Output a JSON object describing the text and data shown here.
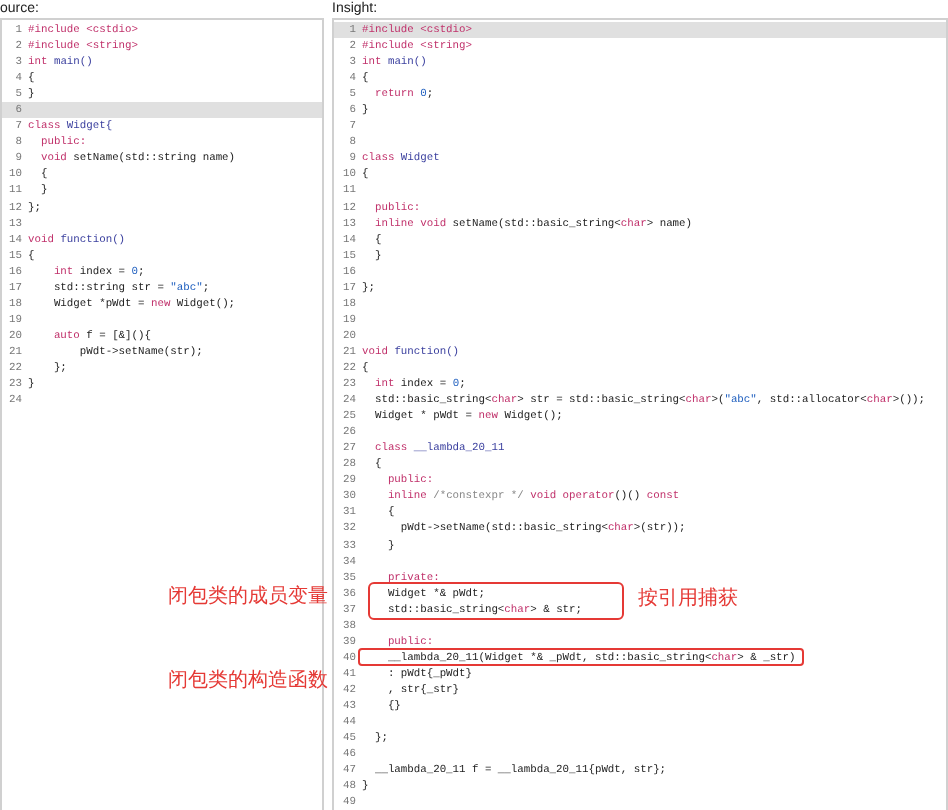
{
  "panes": [
    {
      "label": "ource:",
      "lines": [
        {
          "no": "1",
          "highlighted": false,
          "code": [
            {
              "text": "#include <cstdio>",
              "kind": "kw"
            }
          ]
        },
        {
          "no": "2",
          "highlighted": false,
          "code": [
            {
              "text": "#include <string>",
              "kind": "kw"
            }
          ]
        },
        {
          "no": "3",
          "highlighted": false,
          "code": [
            {
              "text": "int",
              "kind": "kw"
            },
            {
              "text": " main()",
              "kind": "fn"
            }
          ]
        },
        {
          "no": "4",
          "highlighted": false,
          "code": [
            {
              "text": "{",
              "kind": "plain"
            }
          ]
        },
        {
          "no": "5",
          "highlighted": false,
          "code": [
            {
              "text": "}",
              "kind": "plain"
            }
          ]
        },
        {
          "no": "6",
          "highlighted": true
        },
        {
          "no": "7",
          "highlighted": false,
          "code": [
            {
              "text": "class",
              "kind": "kw"
            },
            {
              "text": " Widget{",
              "kind": "fn"
            }
          ]
        },
        {
          "no": "8",
          "highlighted": false,
          "code": [
            {
              "text": "  public:",
              "kind": "kw"
            }
          ]
        },
        {
          "no": "9",
          "highlighted": false,
          "code": [
            {
              "text": "  void",
              "kind": "kw"
            },
            {
              "text": " setName(std::string name)",
              "kind": "plain"
            }
          ]
        },
        {
          "no": "10",
          "highlighted": false,
          "code": [
            {
              "text": "  {",
              "kind": "plain"
            }
          ]
        },
        {
          "no": "11",
          "highlighted": false,
          "code": [
            {
              "text": "  }",
              "kind": "plain"
            }
          ]
        },
        {
          "no": "12",
          "highlighted": false,
          "code": [
            {
              "text": "};",
              "kind": "plain"
            }
          ]
        },
        {
          "no": "13",
          "highlighted": false
        },
        {
          "no": "14",
          "highlighted": false,
          "code": [
            {
              "text": "void",
              "kind": "kw"
            },
            {
              "text": " function()",
              "kind": "fn"
            }
          ]
        },
        {
          "no": "15",
          "highlighted": false,
          "code": [
            {
              "text": "{",
              "kind": "plain"
            }
          ]
        },
        {
          "no": "16",
          "highlighted": false,
          "code": [
            {
              "text": "    int",
              "kind": "kw"
            },
            {
              "text": " index = ",
              "kind": "plain"
            },
            {
              "text": "0",
              "kind": "num"
            },
            {
              "text": ";",
              "kind": "plain"
            }
          ]
        },
        {
          "no": "17",
          "highlighted": false,
          "code": [
            {
              "text": "    std::string str = ",
              "kind": "plain"
            },
            {
              "text": "\"abc\"",
              "kind": "num"
            },
            {
              "text": ";",
              "kind": "plain"
            }
          ]
        },
        {
          "no": "18",
          "highlighted": false,
          "code": [
            {
              "text": "    Widget *pWdt = ",
              "kind": "plain"
            },
            {
              "text": "new",
              "kind": "kw"
            },
            {
              "text": " Widget();",
              "kind": "plain"
            }
          ]
        },
        {
          "no": "19",
          "highlighted": false
        },
        {
          "no": "20",
          "highlighted": false,
          "code": [
            {
              "text": "    auto",
              "kind": "kw"
            },
            {
              "text": " f = [&](){",
              "kind": "plain"
            }
          ]
        },
        {
          "no": "21",
          "highlighted": false,
          "code": [
            {
              "text": "        pWdt->setName(str);",
              "kind": "plain"
            }
          ]
        },
        {
          "no": "22",
          "highlighted": false,
          "code": [
            {
              "text": "    };",
              "kind": "plain"
            }
          ]
        },
        {
          "no": "23",
          "highlighted": false,
          "code": [
            {
              "text": "}",
              "kind": "plain"
            }
          ]
        },
        {
          "no": "24",
          "highlighted": false
        }
      ]
    },
    {
      "label": "Insight:",
      "lines": [
        {
          "no": "1",
          "highlighted": true,
          "code": [
            {
              "text": "#include <cstdio>",
              "kind": "kw"
            }
          ]
        },
        {
          "no": "2",
          "highlighted": false,
          "code": [
            {
              "text": "#include <string>",
              "kind": "kw"
            }
          ]
        },
        {
          "no": "3",
          "highlighted": false,
          "code": [
            {
              "text": "int",
              "kind": "kw"
            },
            {
              "text": " main()",
              "kind": "fn"
            }
          ]
        },
        {
          "no": "4",
          "highlighted": false,
          "code": [
            {
              "text": "{",
              "kind": "plain"
            }
          ]
        },
        {
          "no": "5",
          "highlighted": false,
          "code": [
            {
              "text": "  return",
              "kind": "kw"
            },
            {
              "text": " 0",
              "kind": "num"
            },
            {
              "text": ";",
              "kind": "plain"
            }
          ]
        },
        {
          "no": "6",
          "highlighted": false,
          "code": [
            {
              "text": "}",
              "kind": "plain"
            }
          ]
        },
        {
          "no": "7",
          "highlighted": false
        },
        {
          "no": "8",
          "highlighted": false
        },
        {
          "no": "9",
          "highlighted": false,
          "code": [
            {
              "text": "class",
              "kind": "kw"
            },
            {
              "text": " Widget",
              "kind": "fn"
            }
          ]
        },
        {
          "no": "10",
          "highlighted": false,
          "code": [
            {
              "text": "{",
              "kind": "plain"
            }
          ]
        },
        {
          "no": "11",
          "highlighted": false
        },
        {
          "no": "12",
          "highlighted": false,
          "code": [
            {
              "text": "  public:",
              "kind": "kw"
            }
          ]
        },
        {
          "no": "13",
          "highlighted": false,
          "code": [
            {
              "text": "  inline void",
              "kind": "kw"
            },
            {
              "text": " setName(std::basic_string<",
              "kind": "plain"
            },
            {
              "text": "char",
              "kind": "kw"
            },
            {
              "text": "> name)",
              "kind": "plain"
            }
          ]
        },
        {
          "no": "14",
          "highlighted": false,
          "code": [
            {
              "text": "  {",
              "kind": "plain"
            }
          ]
        },
        {
          "no": "15",
          "highlighted": false,
          "code": [
            {
              "text": "  }",
              "kind": "plain"
            }
          ]
        },
        {
          "no": "16",
          "highlighted": false
        },
        {
          "no": "17",
          "highlighted": false,
          "code": [
            {
              "text": "};",
              "kind": "plain"
            }
          ]
        },
        {
          "no": "18",
          "highlighted": false
        },
        {
          "no": "19",
          "highlighted": false
        },
        {
          "no": "20",
          "highlighted": false
        },
        {
          "no": "21",
          "highlighted": false,
          "code": [
            {
              "text": "void",
              "kind": "kw"
            },
            {
              "text": " function()",
              "kind": "fn"
            }
          ]
        },
        {
          "no": "22",
          "highlighted": false,
          "code": [
            {
              "text": "{",
              "kind": "plain"
            }
          ]
        },
        {
          "no": "23",
          "highlighted": false,
          "code": [
            {
              "text": "  int",
              "kind": "kw"
            },
            {
              "text": " index = ",
              "kind": "plain"
            },
            {
              "text": "0",
              "kind": "num"
            },
            {
              "text": ";",
              "kind": "plain"
            }
          ]
        },
        {
          "no": "24",
          "highlighted": false,
          "code": [
            {
              "text": "  std::basic_string<",
              "kind": "plain"
            },
            {
              "text": "char",
              "kind": "kw"
            },
            {
              "text": "> str = std::basic_string<",
              "kind": "plain"
            },
            {
              "text": "char",
              "kind": "kw"
            },
            {
              "text": ">(",
              "kind": "plain"
            },
            {
              "text": "\"abc\"",
              "kind": "num"
            },
            {
              "text": ", std::allocator<",
              "kind": "plain"
            },
            {
              "text": "char",
              "kind": "kw"
            },
            {
              "text": ">());",
              "kind": "plain"
            }
          ]
        },
        {
          "no": "25",
          "highlighted": false,
          "code": [
            {
              "text": "  Widget * pWdt = ",
              "kind": "plain"
            },
            {
              "text": "new",
              "kind": "kw"
            },
            {
              "text": " Widget();",
              "kind": "plain"
            }
          ]
        },
        {
          "no": "26",
          "highlighted": false
        },
        {
          "no": "27",
          "highlighted": false,
          "code": [
            {
              "text": "  class",
              "kind": "kw"
            },
            {
              "text": " __lambda_20_11",
              "kind": "fn"
            }
          ]
        },
        {
          "no": "28",
          "highlighted": false,
          "code": [
            {
              "text": "  {",
              "kind": "plain"
            }
          ]
        },
        {
          "no": "29",
          "highlighted": false,
          "code": [
            {
              "text": "    public:",
              "kind": "kw"
            }
          ]
        },
        {
          "no": "30",
          "highlighted": false,
          "code": [
            {
              "text": "    inline",
              "kind": "kw"
            },
            {
              "text": " /*constexpr */",
              "kind": "cmt"
            },
            {
              "text": " void operator",
              "kind": "kw"
            },
            {
              "text": "()() ",
              "kind": "plain"
            },
            {
              "text": "const",
              "kind": "kw"
            }
          ]
        },
        {
          "no": "31",
          "highlighted": false,
          "code": [
            {
              "text": "    {",
              "kind": "plain"
            }
          ]
        },
        {
          "no": "32",
          "highlighted": false,
          "code": [
            {
              "text": "      pWdt->setName(std::basic_string<",
              "kind": "plain"
            },
            {
              "text": "char",
              "kind": "kw"
            },
            {
              "text": ">(str));",
              "kind": "plain"
            }
          ]
        },
        {
          "no": "33",
          "highlighted": false,
          "code": [
            {
              "text": "    }",
              "kind": "plain"
            }
          ]
        },
        {
          "no": "34",
          "highlighted": false
        },
        {
          "no": "35",
          "highlighted": false,
          "code": [
            {
              "text": "    private:",
              "kind": "kw"
            }
          ]
        },
        {
          "no": "36",
          "highlighted": false,
          "code": [
            {
              "text": "    Widget *& pWdt;",
              "kind": "plain"
            }
          ]
        },
        {
          "no": "37",
          "highlighted": false,
          "code": [
            {
              "text": "    std::basic_string<",
              "kind": "plain"
            },
            {
              "text": "char",
              "kind": "kw"
            },
            {
              "text": "> & str;",
              "kind": "plain"
            }
          ]
        },
        {
          "no": "38",
          "highlighted": false
        },
        {
          "no": "39",
          "highlighted": false,
          "code": [
            {
              "text": "    public:",
              "kind": "kw"
            }
          ]
        },
        {
          "no": "40",
          "highlighted": false,
          "code": [
            {
              "text": "    __lambda_20_11(Widget *& _pWdt, std::basic_string<",
              "kind": "plain"
            },
            {
              "text": "char",
              "kind": "kw"
            },
            {
              "text": "> & _str)",
              "kind": "plain"
            }
          ]
        },
        {
          "no": "41",
          "highlighted": false,
          "code": [
            {
              "text": "    : pWdt{_pWdt}",
              "kind": "plain"
            }
          ]
        },
        {
          "no": "42",
          "highlighted": false,
          "code": [
            {
              "text": "    , str{_str}",
              "kind": "plain"
            }
          ]
        },
        {
          "no": "43",
          "highlighted": false,
          "code": [
            {
              "text": "    {}",
              "kind": "plain"
            }
          ]
        },
        {
          "no": "44",
          "highlighted": false
        },
        {
          "no": "45",
          "highlighted": false,
          "code": [
            {
              "text": "  };",
              "kind": "plain"
            }
          ]
        },
        {
          "no": "46",
          "highlighted": false
        },
        {
          "no": "47",
          "highlighted": false,
          "code": [
            {
              "text": "  __lambda_20_11 f = __lambda_20_11{pWdt, str};",
              "kind": "plain"
            }
          ]
        },
        {
          "no": "48",
          "highlighted": false,
          "code": [
            {
              "text": "}",
              "kind": "plain"
            }
          ]
        },
        {
          "no": "49",
          "highlighted": false
        }
      ]
    }
  ],
  "annotations": [
    {
      "text": "闭包类的成员变量"
    },
    {
      "text": "按引用捕获"
    },
    {
      "text": "闭包类的构造函数"
    }
  ]
}
